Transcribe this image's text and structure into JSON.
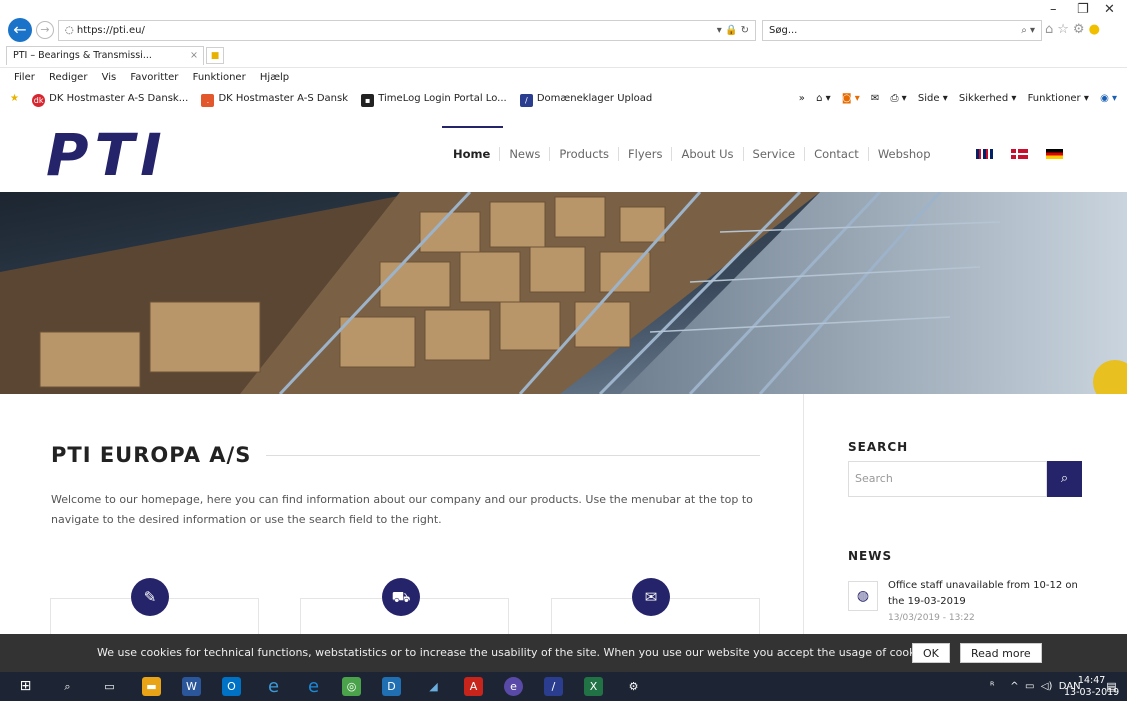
{
  "browser": {
    "url": "https://pti.eu/",
    "search_placeholder": "Søg...",
    "tab_title": "PTI – Bearings & Transmissi...",
    "menu": [
      "Filer",
      "Rediger",
      "Vis",
      "Favoritter",
      "Funktioner",
      "Hjælp"
    ],
    "favorites": [
      {
        "label": "DK Hostmaster A-S Dansk...",
        "icon": "dk-hostmaster-icon",
        "color": "#d7262f"
      },
      {
        "label": "DK Hostmaster A-S Dansk",
        "icon": "hostmaster-icon",
        "color": "#e2572b"
      },
      {
        "label": "TimeLog Login Portal Lo...",
        "icon": "timelog-icon",
        "color": "#222"
      },
      {
        "label": "Domæneklager Upload",
        "icon": "domaeneklager-icon",
        "color": "#2a3d8f"
      }
    ],
    "commands": [
      "Side ▾",
      "Sikkerhed ▾",
      "Funktioner ▾"
    ]
  },
  "site": {
    "logo": "PTI",
    "nav": [
      "Home",
      "News",
      "Products",
      "Flyers",
      "About Us",
      "Service",
      "Contact",
      "Webshop"
    ],
    "title": "PTI EUROPA A/S",
    "intro": "Welcome to our homepage, here you can find information about our company and our products. Use the menubar at the top to navigate to the desired information or use the search field to the right.",
    "sidebar": {
      "search_heading": "SEARCH",
      "search_placeholder": "Search",
      "news_heading": "NEWS",
      "news_title": "Office staff unavailable from 10-12 on the 19-03-2019",
      "news_date": "13/03/2019 - 13:22"
    },
    "cookie": {
      "text": "We use cookies for technical functions, webstatistics or to increase the usability of the site. When you use our website you accept the usage of cookies.",
      "ok": "OK",
      "more": "Read more"
    },
    "accent": "#25246b"
  },
  "taskbar": {
    "lang": "DAN",
    "time": "14:47",
    "date": "13-03-2019"
  }
}
